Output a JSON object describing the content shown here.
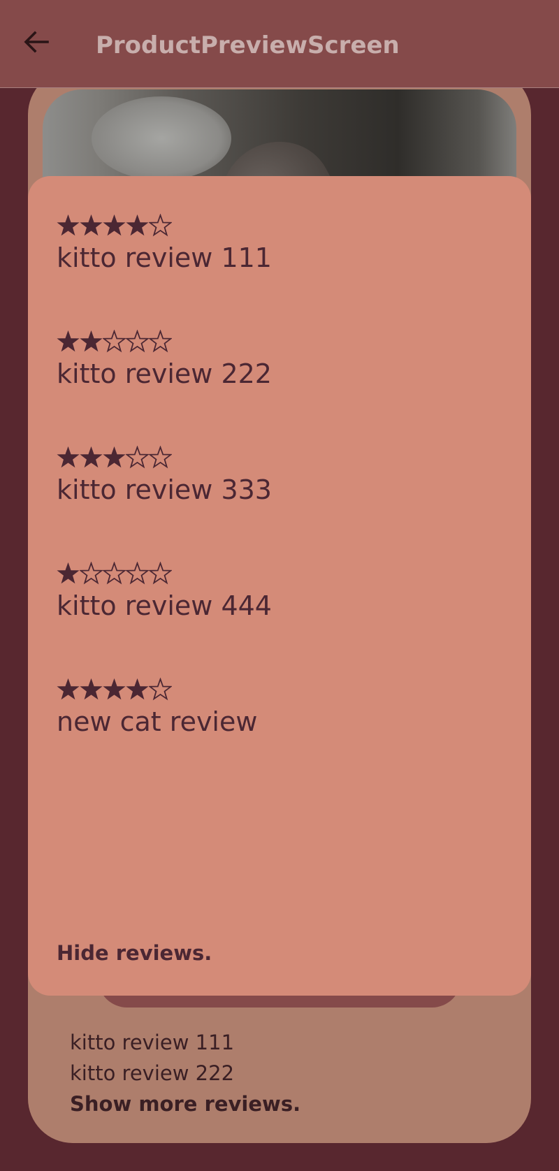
{
  "app_bar": {
    "title": "ProductPreviewScreen",
    "back_icon": "arrow-left-icon"
  },
  "reviews_sheet": {
    "reviews": [
      {
        "rating": 4,
        "max_rating": 5,
        "text": "kitto review 111"
      },
      {
        "rating": 2,
        "max_rating": 5,
        "text": "kitto review 222"
      },
      {
        "rating": 3,
        "max_rating": 5,
        "text": "kitto review 333"
      },
      {
        "rating": 1,
        "max_rating": 5,
        "text": "kitto review 444"
      },
      {
        "rating": 4,
        "max_rating": 5,
        "text": "new cat review"
      }
    ],
    "hide_label": "Hide reviews."
  },
  "product_card": {
    "preview_reviews": [
      "kitto review 111",
      "kitto review 222"
    ],
    "show_more_label": "Show more reviews."
  },
  "colors": {
    "background": "#58272f",
    "app_bar": "#854a4a",
    "card": "#ae7e6c",
    "sheet": "#d48b78",
    "text_dark": "#4b2733"
  }
}
